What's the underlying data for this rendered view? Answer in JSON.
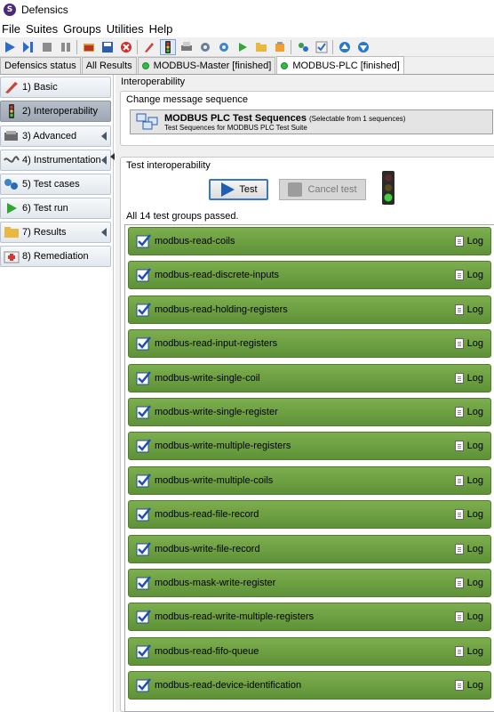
{
  "window": {
    "title": "Defensics"
  },
  "menu": [
    "File",
    "Suites",
    "Groups",
    "Utilities",
    "Help"
  ],
  "toolbar": {
    "icons": [
      "run-icon",
      "run-all-icon",
      "stop-icon",
      "pause-icon",
      "open-icon",
      "save-icon",
      "close-red-icon",
      "edit-icon",
      "traffic-light-icon",
      "print-icon",
      "settings-icon",
      "gear-icon",
      "play-icon",
      "folder-icon",
      "fix-icon",
      "plugin-icon",
      "check-icon",
      "up-icon",
      "down-icon"
    ]
  },
  "tabs": [
    {
      "label": "Defensics status",
      "status": ""
    },
    {
      "label": "All Results",
      "status": ""
    },
    {
      "label": "MODBUS-Master [finished]",
      "status": "finished"
    },
    {
      "label": "MODBUS-PLC [finished]",
      "status": "finished",
      "selected": true
    }
  ],
  "sidebar": {
    "items": [
      {
        "label": "1) Basic",
        "icon": "basic-icon",
        "arrow": false
      },
      {
        "label": "2) Interoperability",
        "icon": "traffic-light-icon",
        "arrow": false,
        "selected": true
      },
      {
        "label": "3) Advanced",
        "icon": "advanced-icon",
        "arrow": true
      },
      {
        "label": "4) Instrumentation",
        "icon": "instrumentation-icon",
        "arrow": true
      },
      {
        "label": "5) Test cases",
        "icon": "test-cases-icon",
        "arrow": false
      },
      {
        "label": "6) Test run",
        "icon": "play-icon",
        "arrow": false
      },
      {
        "label": "7) Results",
        "icon": "folder-icon",
        "arrow": true
      },
      {
        "label": "8) Remediation",
        "icon": "remediation-icon",
        "arrow": false
      }
    ]
  },
  "main": {
    "header": "Interoperability",
    "sequence_panel": {
      "title": "Change message sequence",
      "name": "MODBUS PLC Test Sequences",
      "hint": "(Selectable from 1 sequences)",
      "description": "Test Sequences for MODBUS PLC Test Suite"
    },
    "test_panel": {
      "title": "Test interoperability",
      "test_button": "Test",
      "cancel_button": "Cancel test",
      "status": "All 14 test groups passed.",
      "log_label": "Log",
      "groups": [
        "modbus-read-coils",
        "modbus-read-discrete-inputs",
        "modbus-read-holding-registers",
        "modbus-read-input-registers",
        "modbus-write-single-coil",
        "modbus-write-single-register",
        "modbus-write-multiple-registers",
        "modbus-write-multiple-coils",
        "modbus-read-file-record",
        "modbus-write-file-record",
        "modbus-mask-write-register",
        "modbus-read-write-multiple-registers",
        "modbus-read-fifo-queue",
        "modbus-read-device-identification"
      ]
    }
  },
  "colors": {
    "pass_green": "#6ea043",
    "accent_blue": "#3a78c0",
    "status_green": "#33b94a"
  }
}
